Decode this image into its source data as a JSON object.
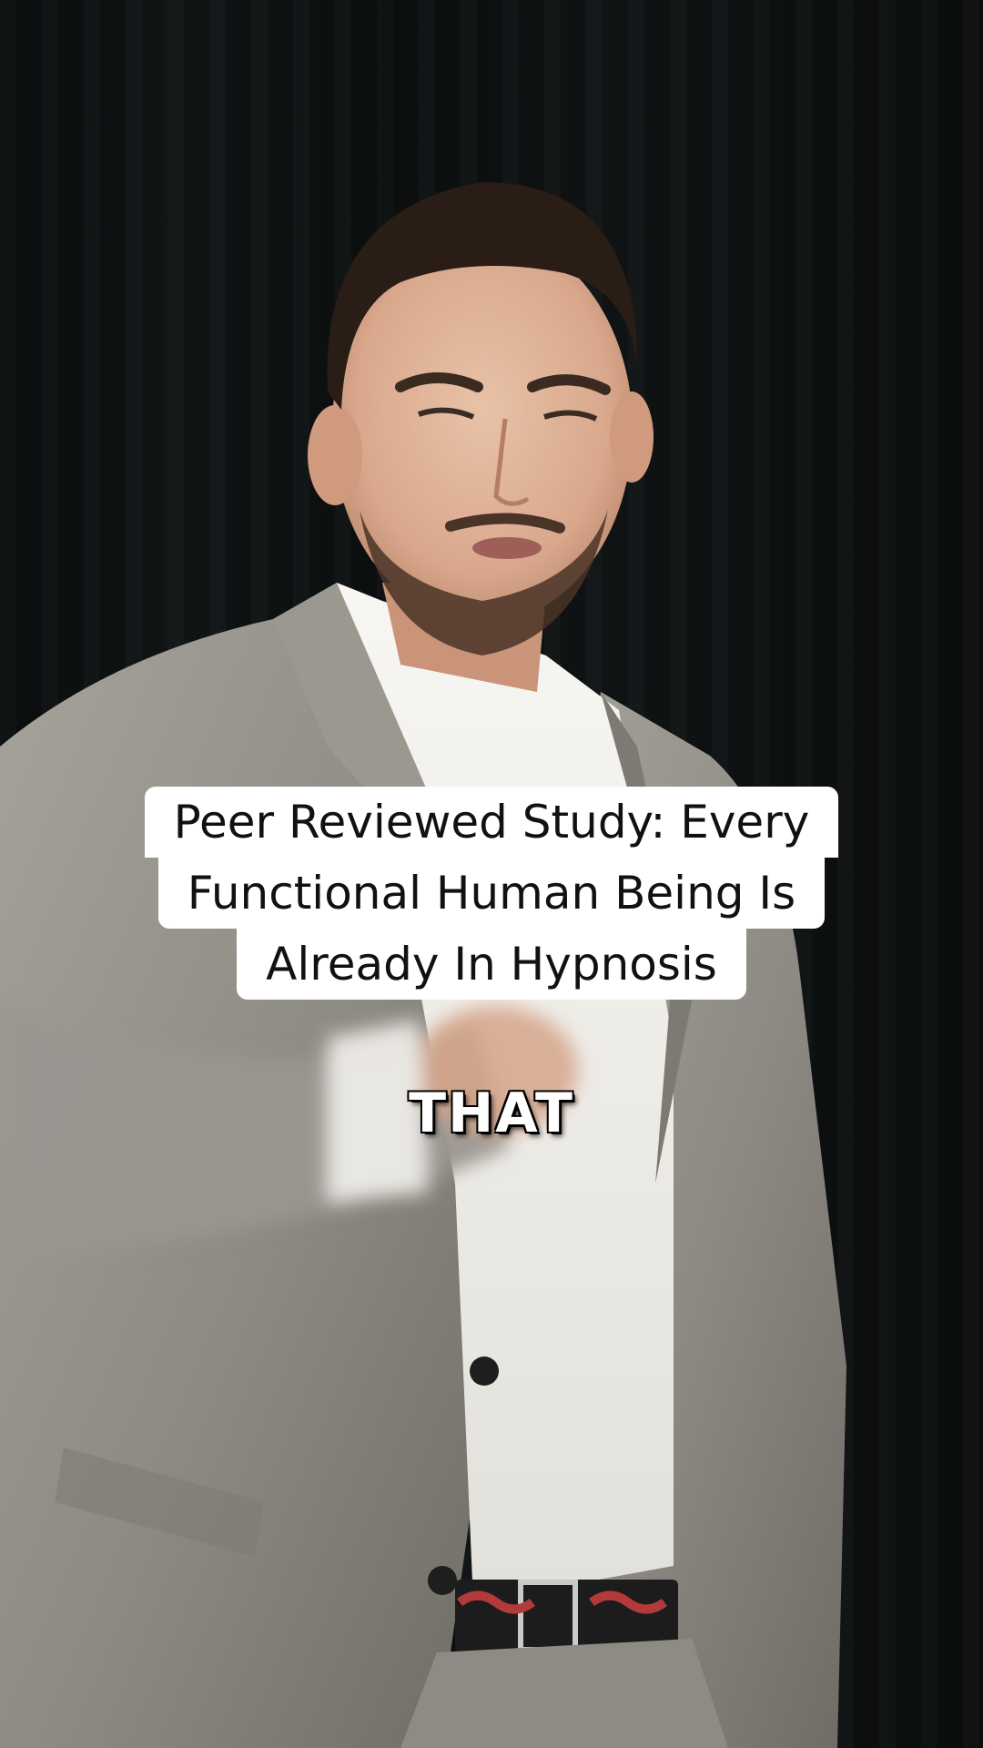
{
  "overlay_caption": {
    "lines": [
      "Peer Reviewed Study: Every",
      "Functional Human Being Is",
      "Already In Hypnosis"
    ]
  },
  "subtitle": {
    "word": "THAT"
  },
  "colors": {
    "caption_bg": "#ffffff",
    "caption_text": "#111111",
    "subtitle_text": "#ffffff",
    "background": "#0b0e0f",
    "suit": "#8f8c85"
  }
}
